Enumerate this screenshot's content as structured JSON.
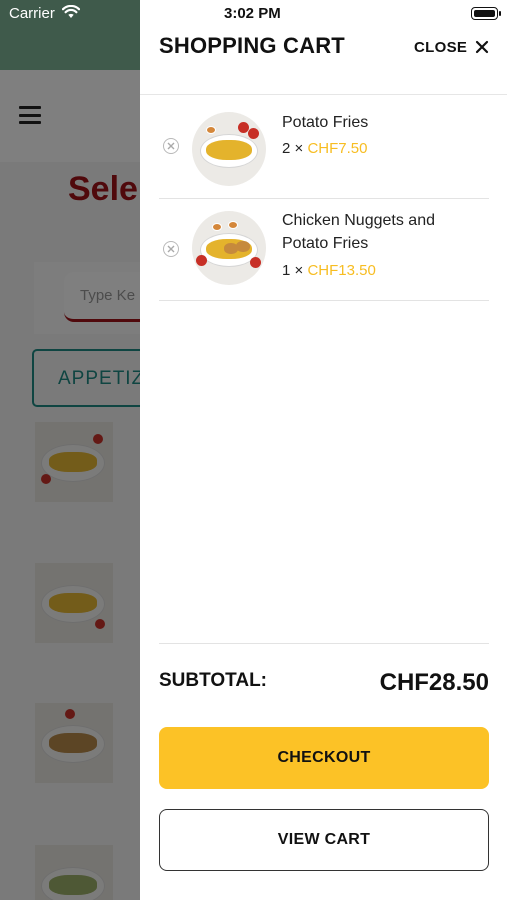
{
  "status_bar": {
    "carrier": "Carrier",
    "time": "3:02 PM",
    "wifi_icon": "wifi-icon",
    "battery_icon": "battery-icon"
  },
  "background": {
    "title": "Sele",
    "search_placeholder": "Type Ke",
    "tab_label": "APPETIZ",
    "menu_icon": "hamburger-menu-icon"
  },
  "cart": {
    "title": "SHOPPING CART",
    "close_label": "CLOSE",
    "items": [
      {
        "name": "Potato Fries",
        "quantity": "2",
        "times": "×",
        "price": "CHF7.50"
      },
      {
        "name": "Chicken Nuggets and Potato Fries",
        "quantity": "1",
        "times": "×",
        "price": "CHF13.50"
      }
    ],
    "subtotal_label": "SUBTOTAL:",
    "subtotal_value": "CHF28.50",
    "checkout_label": "CHECKOUT",
    "view_cart_label": "VIEW CART"
  },
  "colors": {
    "accent": "#fcc226",
    "price": "#f7bd22",
    "header_green": "#7fb597",
    "brand_red": "#a01218",
    "tab_teal": "#1f8a84"
  }
}
